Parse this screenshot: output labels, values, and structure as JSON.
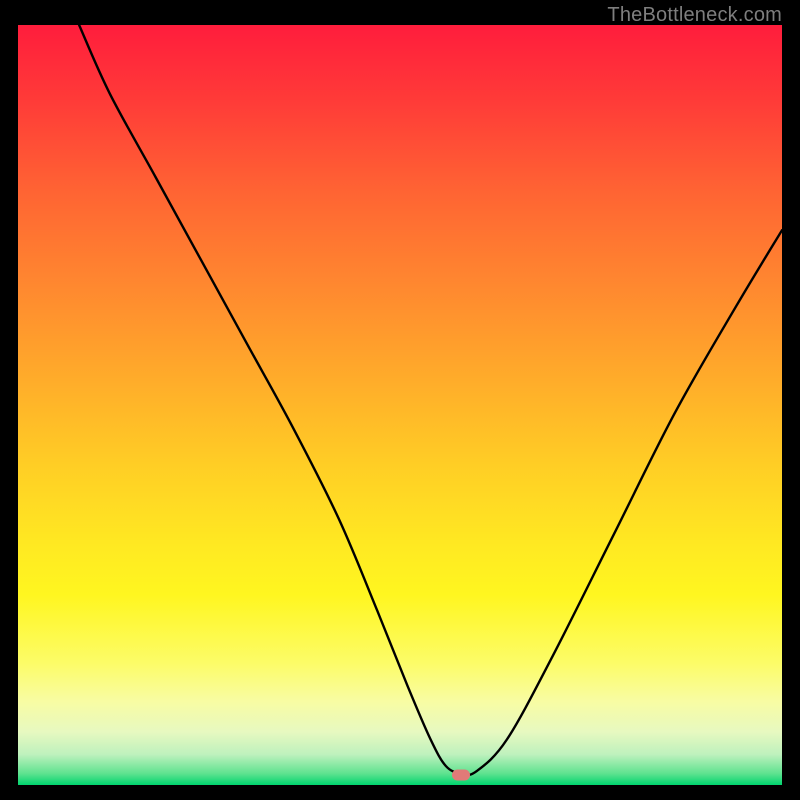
{
  "watermark": "TheBottleneck.com",
  "chart_data": {
    "type": "line",
    "title": "",
    "xlabel": "",
    "ylabel": "",
    "xlim": [
      0,
      100
    ],
    "ylim": [
      0,
      100
    ],
    "grid": false,
    "legend": false,
    "series": [
      {
        "name": "bottleneck-curve",
        "x": [
          8,
          12,
          18,
          24,
          30,
          36,
          42,
          47,
          51,
          54,
          56,
          58,
          60,
          64,
          70,
          78,
          86,
          94,
          100
        ],
        "values": [
          100,
          91,
          80,
          69,
          58,
          47,
          35,
          23,
          13,
          6,
          2.5,
          1.5,
          1.8,
          6,
          17,
          33,
          49,
          63,
          73
        ]
      }
    ],
    "annotations": [
      {
        "name": "minimum-marker",
        "x": 58,
        "y": 1.3,
        "color": "#e07a78"
      }
    ],
    "background_gradient": {
      "top_color": "#ff1d3c",
      "bottom_color": "#00d46e"
    }
  }
}
